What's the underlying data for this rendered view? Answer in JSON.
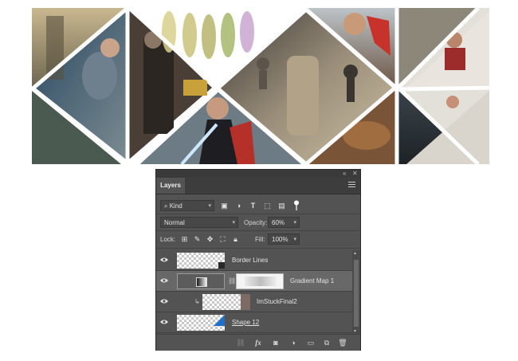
{
  "panel": {
    "tab_label": "Layers",
    "collapse_glyph": "«",
    "close_glyph": "✕",
    "filter": {
      "label": "Kind",
      "icon": "search-icon"
    },
    "blend_mode": "Normal",
    "opacity_label": "Opacity:",
    "opacity_value": "60%",
    "lock_label": "Lock:",
    "fill_label": "Fill:",
    "fill_value": "100%",
    "layers": [
      {
        "name": "Border Lines",
        "visible": true,
        "selected": false
      },
      {
        "name": "Gradient Map 1",
        "visible": true,
        "selected": true
      },
      {
        "name": "ImStuckFinal2",
        "visible": true,
        "selected": false,
        "clipped": true
      },
      {
        "name": "Shape 12",
        "visible": true,
        "selected": false
      }
    ],
    "bottom_icons": [
      "link-icon",
      "fx-icon",
      "mask-icon",
      "adjustment-icon",
      "folder-icon",
      "new-layer-icon",
      "trash-icon"
    ],
    "fx_label": "fx"
  },
  "colors": {
    "panel_bg": "#535353",
    "selected_row": "#686868",
    "accent_blue": "#1f6fc9"
  }
}
